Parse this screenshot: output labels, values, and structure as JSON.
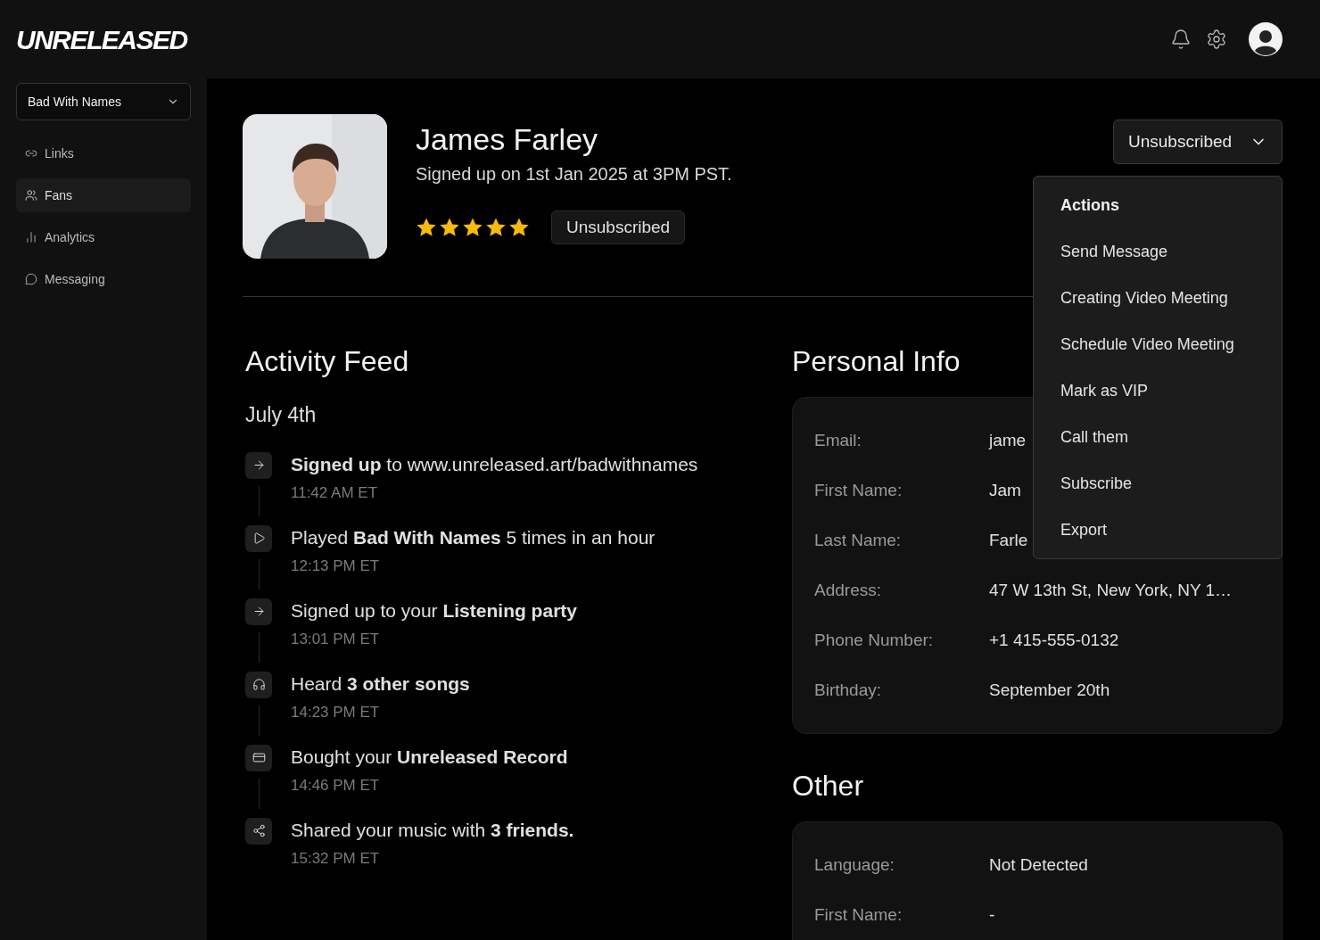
{
  "brand": "UNRELEASED",
  "artist_select": {
    "value": "Bad With Names"
  },
  "sidebar": {
    "items": [
      {
        "label": "Links",
        "selected": false
      },
      {
        "label": "Fans",
        "selected": true
      },
      {
        "label": "Analytics",
        "selected": false
      },
      {
        "label": "Messaging",
        "selected": false
      }
    ]
  },
  "profile": {
    "name": "James Farley",
    "signed_up": "Signed up on 1st Jan 2025 at 3PM PST.",
    "stars": 5,
    "status_badge": "Unsubscribed"
  },
  "status_dropdown": {
    "value": "Unsubscribed",
    "expanded": true,
    "menu": {
      "header": "Actions",
      "items": [
        "Send Message",
        "Creating Video Meeting",
        "Schedule Video Meeting",
        "Mark as VIP",
        "Call them",
        "Subscribe",
        "Export"
      ]
    }
  },
  "activity_feed": {
    "title": "Activity Feed",
    "date": "July 4th",
    "items": [
      {
        "text": "**Signed up** to www.unreleased.art/badwithnames",
        "time": "11:42 AM ET"
      },
      {
        "text": "Played **Bad With Names** 5 times in an hour",
        "time": "12:13 PM ET"
      },
      {
        "text": "Signed up to your **Listening party**",
        "time": "13:01 PM ET"
      },
      {
        "text": "Heard **3 other songs**",
        "time": "14:23 PM ET"
      },
      {
        "text": "Bought your **Unreleased Record**",
        "time": "14:46 PM ET"
      },
      {
        "text": "Shared your music with **3 friends.**",
        "time": "15:32 PM ET"
      }
    ]
  },
  "personal_info": {
    "title": "Personal Info",
    "rows": [
      {
        "label": "Email:",
        "value": "jame"
      },
      {
        "label": "First Name:",
        "value": "Jam"
      },
      {
        "label": "Last Name:",
        "value": "Farle"
      },
      {
        "label": "Address:",
        "value": "47 W 13th St, New York, NY 1…"
      },
      {
        "label": "Phone Number:",
        "value": "+1 415-555-0132"
      },
      {
        "label": "Birthday:",
        "value": "September 20th"
      }
    ]
  },
  "other": {
    "title": "Other",
    "rows": [
      {
        "label": "Language:",
        "value": "Not Detected"
      },
      {
        "label": "First Name:",
        "value": "-"
      }
    ]
  }
}
